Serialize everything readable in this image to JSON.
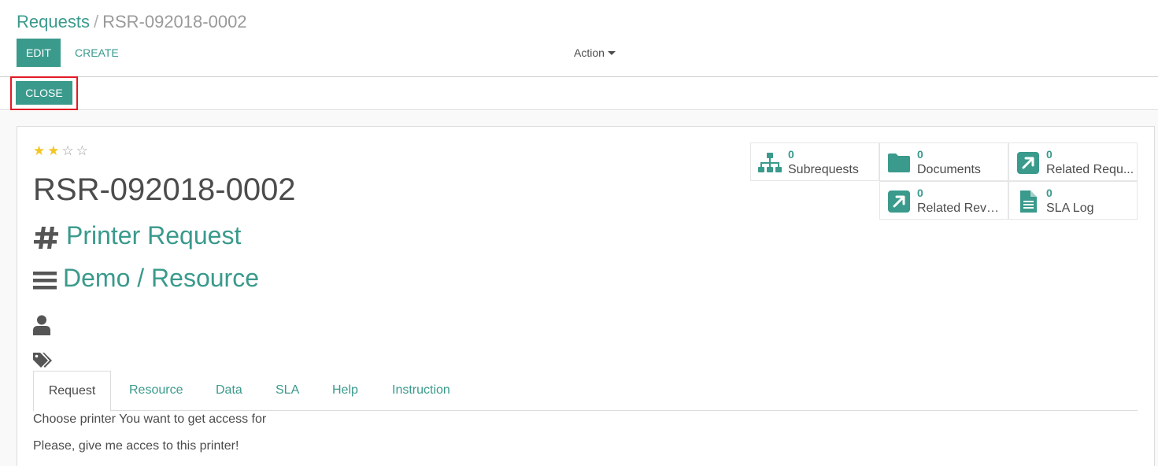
{
  "breadcrumb": {
    "parent": "Requests",
    "separator": "/",
    "current": "RSR-092018-0002"
  },
  "toolbar": {
    "edit_label": "EDIT",
    "create_label": "CREATE",
    "action_label": "Action"
  },
  "statusbar": {
    "close_label": "CLOSE"
  },
  "record": {
    "priority_stars_filled": 2,
    "priority_stars_total": 4,
    "name": "RSR-092018-0002",
    "type": "Printer Request",
    "category": "Demo / Resource"
  },
  "smart_buttons": [
    {
      "count": "0",
      "label": "Subrequests",
      "icon": "sitemap-icon"
    },
    {
      "count": "0",
      "label": "Documents",
      "icon": "folder-icon"
    },
    {
      "count": "0",
      "label": "Related Requ...",
      "icon": "external-link-icon"
    },
    {
      "count": "0",
      "label": "Related Rever...",
      "icon": "external-link-icon"
    },
    {
      "count": "0",
      "label": "SLA Log",
      "icon": "file-text-icon"
    }
  ],
  "tabs": [
    {
      "label": "Request",
      "active": true
    },
    {
      "label": "Resource",
      "active": false
    },
    {
      "label": "Data",
      "active": false
    },
    {
      "label": "SLA",
      "active": false
    },
    {
      "label": "Help",
      "active": false
    },
    {
      "label": "Instruction",
      "active": false
    }
  ],
  "request_text": {
    "line1": "Choose printer You want to get access for",
    "line2": "Please, give me acces to this printer!"
  },
  "colors": {
    "accent": "#3a9a8c",
    "star": "#f3c622",
    "highlight": "#e01b24"
  }
}
